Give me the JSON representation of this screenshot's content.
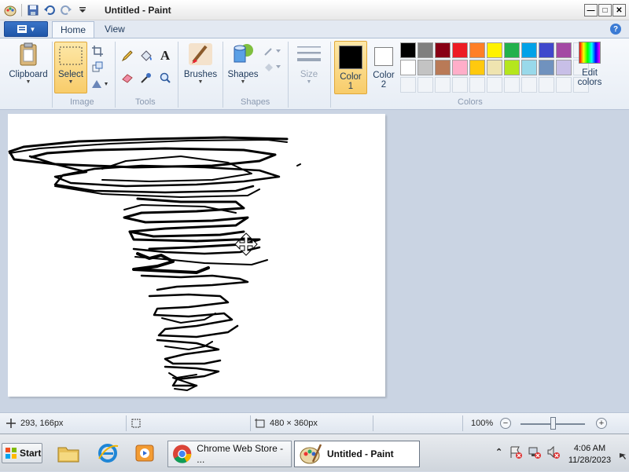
{
  "window": {
    "title": "Untitled - Paint"
  },
  "tabs": [
    {
      "label": "Home"
    },
    {
      "label": "View"
    }
  ],
  "ribbon": {
    "clipboard": {
      "label": "Clipboard"
    },
    "select": {
      "label": "Select"
    },
    "image_group": "Image",
    "tools_group": "Tools",
    "brushes": {
      "label": "Brushes"
    },
    "shapes": {
      "label": "Shapes"
    },
    "shapes_group": "Shapes",
    "size": {
      "label": "Size"
    },
    "color1": {
      "label": "Color",
      "num": "1",
      "value": "#000000"
    },
    "color2": {
      "label": "Color",
      "num": "2",
      "value": "#ffffff"
    },
    "colors_group": "Colors",
    "edit_colors": {
      "line1": "Edit",
      "line2": "colors"
    },
    "palette_row1": [
      "#000000",
      "#7f7f7f",
      "#880015",
      "#ed1c24",
      "#ff7f27",
      "#fff200",
      "#22b14c",
      "#00a2e8",
      "#3f48cc",
      "#a349a4"
    ],
    "palette_row2": [
      "#ffffff",
      "#c3c3c3",
      "#b97a57",
      "#ffaec9",
      "#ffc90e",
      "#efe4b0",
      "#b5e61d",
      "#99d9ea",
      "#7092be",
      "#c8bfe7"
    ]
  },
  "status": {
    "cursor_pos": "293, 166px",
    "image_size": "480 × 360px",
    "zoom": "100%",
    "zoom_level": 0.5
  },
  "taskbar": {
    "start_label": "Start",
    "chrome_task": "Chrome Web Store - ...",
    "paint_task": "Untitled - Paint",
    "time": "4:06 AM",
    "date": "11/28/2023"
  }
}
